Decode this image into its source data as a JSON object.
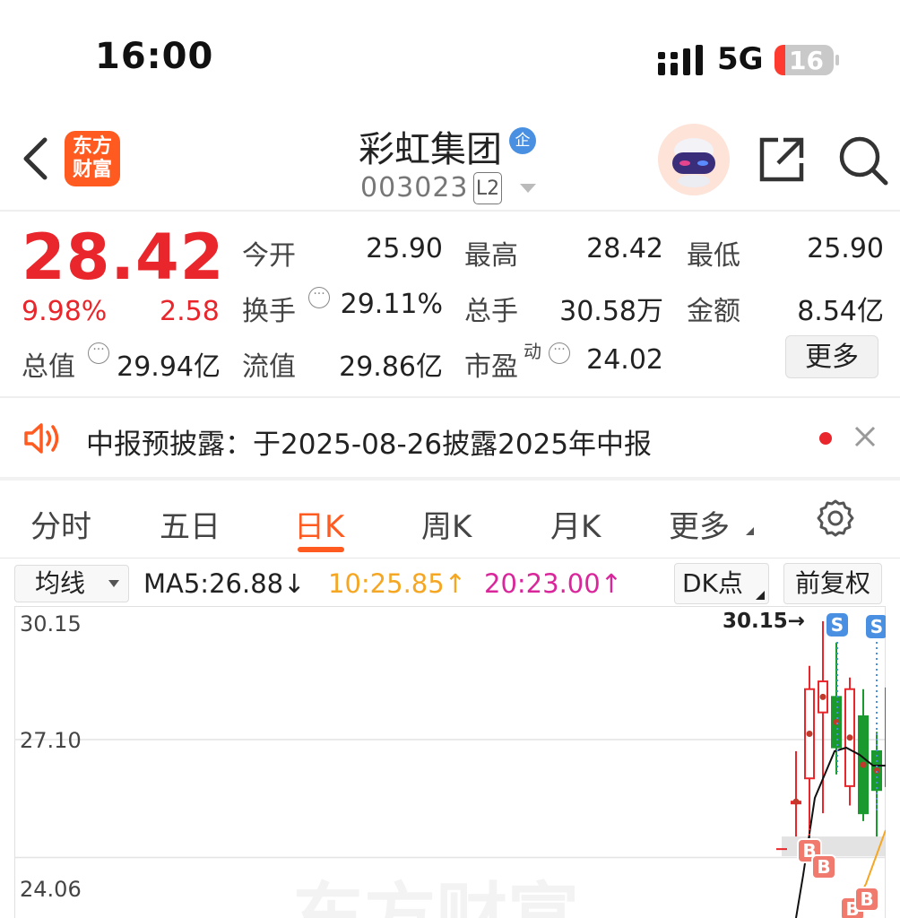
{
  "status_bar": {
    "time": "16:00",
    "network": "5G",
    "battery": "16"
  },
  "header": {
    "name": "彩虹集团",
    "badge": "企",
    "code": "003023",
    "level": "L2",
    "logo_lines": [
      "东方",
      "财富"
    ]
  },
  "quote": {
    "price": "28.42",
    "change_pct": "9.98%",
    "change_amt": "2.58",
    "open_label": "今开",
    "open": "25.90",
    "high_label": "最高",
    "high": "28.42",
    "low_label": "最低",
    "low": "25.90",
    "turnover_label": "换手",
    "turnover": "29.11%",
    "volume_label": "总手",
    "volume": "30.58万",
    "amount_label": "金额",
    "amount": "8.54亿",
    "mktcap_label": "总值",
    "mktcap": "29.94亿",
    "float_label": "流值",
    "float": "29.86亿",
    "pe_label": "市盈",
    "pe_sup": "动",
    "pe": "24.02",
    "more": "更多"
  },
  "notice": {
    "text": "中报预披露：于2025-08-26披露2025年中报"
  },
  "tabs": [
    {
      "label": "分时"
    },
    {
      "label": "五日"
    },
    {
      "label": "日K"
    },
    {
      "label": "周K"
    },
    {
      "label": "月K"
    },
    {
      "label": "更多"
    }
  ],
  "ma_bar": {
    "select": "均线",
    "ma5": "MA5:26.88↓",
    "ma10": "10:25.85↑",
    "ma20": "20:23.00↑",
    "dk": "DK点",
    "adjust": "前复权"
  },
  "colors": {
    "up": "#e8262b",
    "down": "#1a9a2e",
    "accent": "#ff5a1f",
    "ma10": "#f5a623",
    "ma20": "#d9279b"
  },
  "chart_data": {
    "type": "candlestick",
    "y_ticks": [
      "30.15",
      "27.10",
      "24.06"
    ],
    "ylim": [
      22.5,
      30.15
    ],
    "high_marker": "30.15→",
    "candles": [
      {
        "o": 25.5,
        "h": 26.8,
        "l": 24.6,
        "c": 25.5,
        "up": true
      },
      {
        "o": 26.1,
        "h": 29.0,
        "l": 24.0,
        "c": 28.4,
        "up": true
      },
      {
        "o": 27.8,
        "h": 30.15,
        "l": 25.2,
        "c": 28.6,
        "up": true
      },
      {
        "o": 28.2,
        "h": 29.6,
        "l": 26.2,
        "c": 26.9,
        "up": false
      },
      {
        "o": 25.9,
        "h": 28.7,
        "l": 25.4,
        "c": 28.4,
        "up": true
      },
      {
        "o": 27.7,
        "h": 28.4,
        "l": 25.0,
        "c": 25.2,
        "up": false
      },
      {
        "o": 26.8,
        "h": 27.3,
        "l": 24.6,
        "c": 25.8,
        "up": false
      },
      {
        "o": 25.9,
        "h": 29.5,
        "l": 25.2,
        "c": 28.42,
        "up": true
      }
    ],
    "signals": {
      "s": "S",
      "b": "B"
    }
  }
}
